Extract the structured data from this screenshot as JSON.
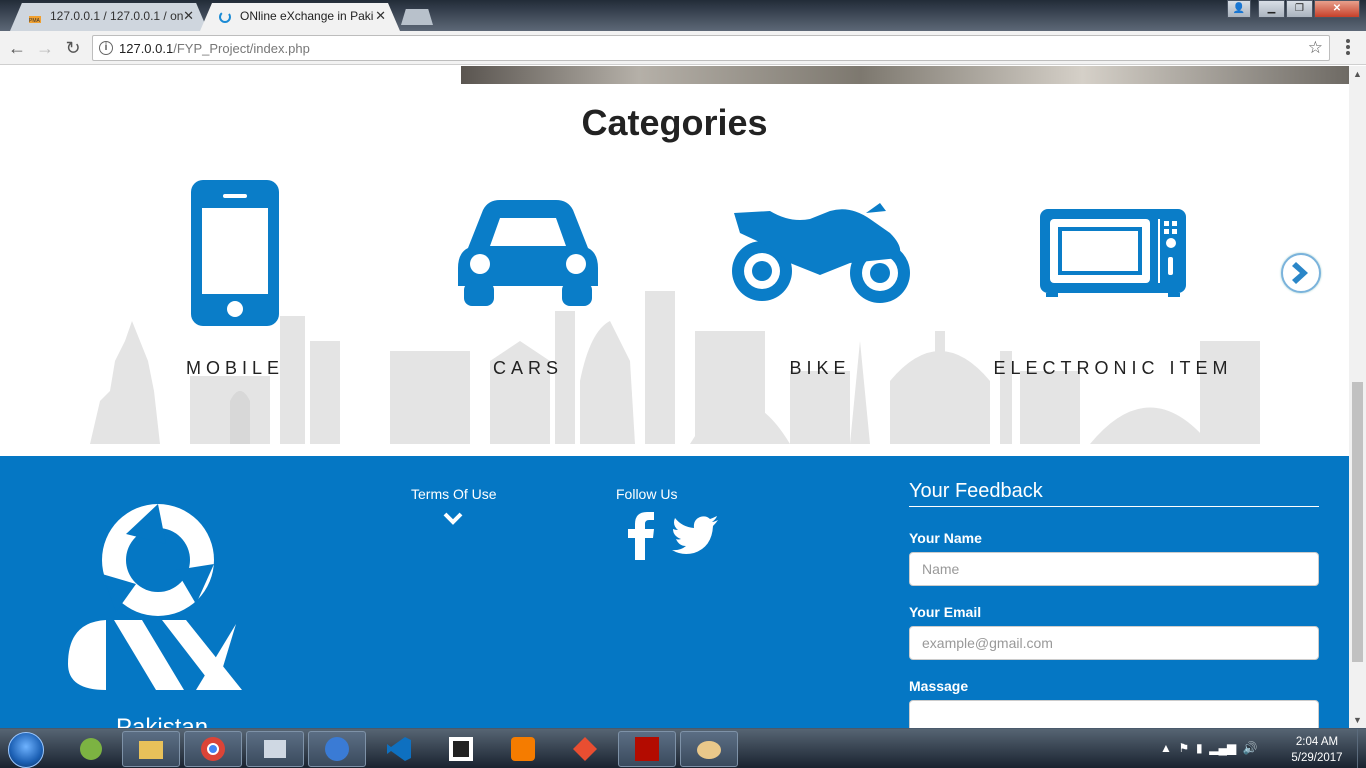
{
  "browser": {
    "tabs": [
      {
        "label": "127.0.0.1 / 127.0.0.1 / on",
        "favicon": "phpmyadmin-icon",
        "active": false
      },
      {
        "label": "ONline eXchange in Paki",
        "favicon": "onx-loading-icon",
        "active": true
      }
    ],
    "url_host": "127.0.0.1",
    "url_path": "/FYP_Project/index.php"
  },
  "page": {
    "categories_title": "Categories",
    "categories": [
      {
        "label": "MOBILE",
        "icon": "mobile-phone-icon"
      },
      {
        "label": "CARS",
        "icon": "car-icon"
      },
      {
        "label": "BIKE",
        "icon": "motorbike-icon"
      },
      {
        "label": "ELECTRONIC ITEM",
        "icon": "microwave-icon"
      }
    ],
    "colors": {
      "brand_blue": "#0577c4",
      "icon_blue": "#0a7dc8",
      "skyline_gray": "#e2e2e2"
    }
  },
  "footer": {
    "logo_country": "Pakistan",
    "terms_label": "Terms Of Use",
    "follow_label": "Follow Us",
    "feedback": {
      "title": "Your Feedback",
      "name_label": "Your Name",
      "name_placeholder": "Name",
      "email_label": "Your Email",
      "email_placeholder": "example@gmail.com",
      "message_label": "Massage"
    }
  },
  "taskbar": {
    "apps": [
      "android-studio-icon",
      "file-explorer-icon",
      "chrome-icon",
      "task-manager-icon",
      "globe-icon",
      "visual-studio-icon",
      "brackets-icon",
      "xampp-icon",
      "git-icon",
      "acrobat-icon",
      "paint-icon"
    ],
    "time": "2:04 AM",
    "date": "5/29/2017"
  }
}
